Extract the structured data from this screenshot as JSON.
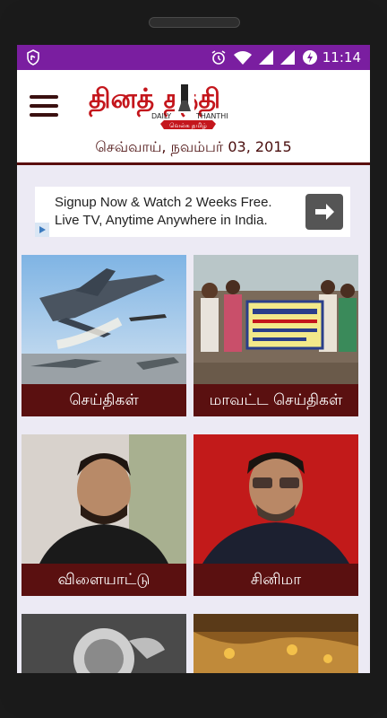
{
  "status_bar": {
    "time": "11:14",
    "icons": [
      "app-notification-icon",
      "alarm-icon",
      "wifi-icon",
      "signal-icon",
      "signal-icon",
      "battery-charging-icon"
    ]
  },
  "header": {
    "logo_text": "தினத் தந்தி",
    "logo_sub_left": "DAILY",
    "logo_sub_right": "THANTHI",
    "logo_tagline": "வெல்க தமிழ்",
    "date": "செவ்வாய், நவம்பர் 03, 2015"
  },
  "ad": {
    "line1": "Signup Now & Watch 2 Weeks Free.",
    "line2": "Live TV, Anytime Anywhere in India."
  },
  "tiles": [
    {
      "label": "செய்திகள்"
    },
    {
      "label": "மாவட்ட செய்திகள்"
    },
    {
      "label": "விளையாட்டு"
    },
    {
      "label": "சினிமா"
    },
    {
      "label": ""
    },
    {
      "label": ""
    }
  ],
  "colors": {
    "status_bar": "#7a1ea0",
    "tile_label_bg": "#5a1010",
    "logo_red": "#c4161c",
    "date_text": "#4a0e0e"
  }
}
